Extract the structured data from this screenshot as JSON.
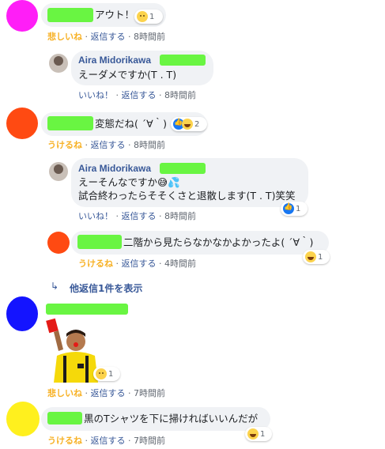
{
  "comments": [
    {
      "text": "アウト！",
      "reaction": {
        "count": "1",
        "emoji": "sad-emoji"
      },
      "actions": {
        "react": "悲しいね",
        "react_color": "#f7b125",
        "reply": "返信する",
        "time": "8時間前"
      },
      "avatar_color": "#ff1ef7"
    },
    {
      "author": "Aira Midorikawa",
      "text": "えーダメですか(T . T)",
      "actions": {
        "react": "いいね！",
        "reply": "返信する",
        "time": "8時間前"
      }
    },
    {
      "text": "変態だね( ´∀｀)",
      "reaction": {
        "count": "2",
        "emoji": "like-laugh-emoji"
      },
      "actions": {
        "react": "うけるね",
        "react_color": "#f7b125",
        "reply": "返信する",
        "time": "8時間前"
      },
      "avatar_color": "#ff4a12"
    },
    {
      "author": "Aira Midorikawa",
      "text_line1": "えーそんなですか😅💦",
      "text_line2": "試合終わったらそそくさと退散します(T . T)笑笑",
      "reaction": {
        "count": "1",
        "emoji": "like-emoji"
      },
      "actions": {
        "react": "いいね！",
        "reply": "返信する",
        "time": "8時間前"
      }
    },
    {
      "text": "二階から見たらなかなかよかったよ( ´∀｀)",
      "reaction": {
        "count": "1",
        "emoji": "laugh-emoji"
      },
      "actions": {
        "react": "うけるね",
        "react_color": "#f7b125",
        "reply": "返信する",
        "time": "4時間前"
      },
      "avatar_color": "#ff4a12"
    },
    {
      "more_replies": "他返信1件を表示"
    },
    {
      "sticker": "referee-red-card-sticker",
      "reaction": {
        "count": "1",
        "emoji": "sad-emoji"
      },
      "actions": {
        "react": "悲しいね",
        "react_color": "#f7b125",
        "reply": "返信する",
        "time": "7時間前"
      },
      "avatar_color": "#1414ff"
    },
    {
      "text": "黒のTシャツを下に掃ければいいんだが",
      "reaction": {
        "count": "1",
        "emoji": "laugh-emoji"
      },
      "actions": {
        "react": "うけるね",
        "react_color": "#f7b125",
        "reply": "返信する",
        "time": "7時間前"
      },
      "avatar_color": "#fff01e"
    }
  ],
  "separator": "·",
  "redaction_color": "#69f542"
}
